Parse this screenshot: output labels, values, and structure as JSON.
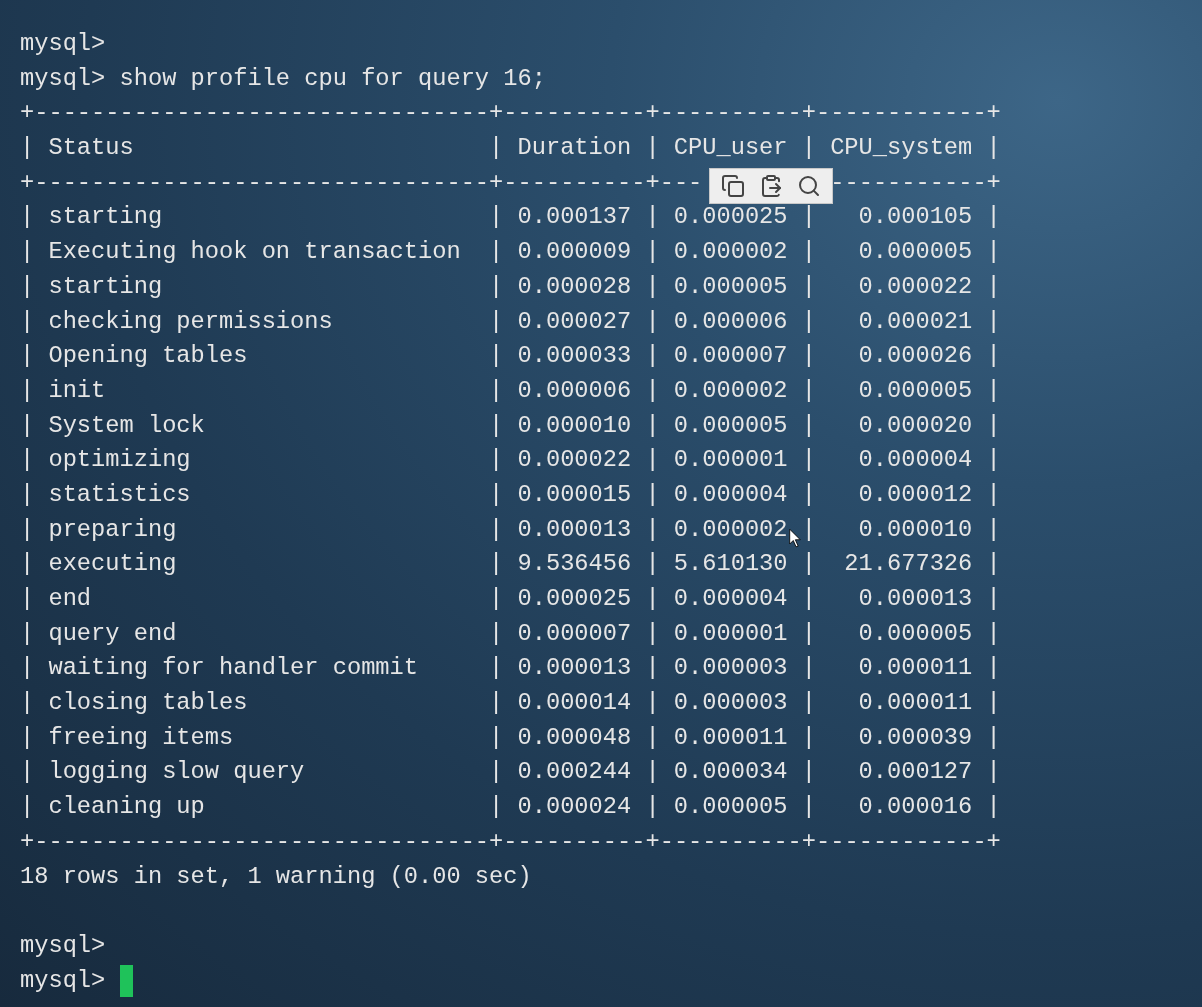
{
  "terminal": {
    "lines_before": [
      {
        "prompt": "mysql>",
        "cursor": false
      },
      {
        "prompt": "mysql>",
        "command": "show profile cpu for query 16;",
        "cursor": false
      }
    ],
    "table": {
      "border": {
        "corner": "+",
        "horizontal": "-",
        "vertical": "|"
      },
      "columns": [
        {
          "label": "Status"
        },
        {
          "label": "Duration"
        },
        {
          "label": "CPU_user"
        },
        {
          "label": "CPU_system"
        }
      ],
      "header_rule_visible_parts": [
        "+--------------------------------+----------+---",
        "-----------+"
      ],
      "rows": [
        [
          "starting",
          "0.000137",
          "0.000025",
          "0.000105"
        ],
        [
          "Executing hook on transaction",
          "0.000009",
          "0.000002",
          "0.000005"
        ],
        [
          "starting",
          "0.000028",
          "0.000005",
          "0.000022"
        ],
        [
          "checking permissions",
          "0.000027",
          "0.000006",
          "0.000021"
        ],
        [
          "Opening tables",
          "0.000033",
          "0.000007",
          "0.000026"
        ],
        [
          "init",
          "0.000006",
          "0.000002",
          "0.000005"
        ],
        [
          "System lock",
          "0.000010",
          "0.000005",
          "0.000020"
        ],
        [
          "optimizing",
          "0.000022",
          "0.000001",
          "0.000004"
        ],
        [
          "statistics",
          "0.000015",
          "0.000004",
          "0.000012"
        ],
        [
          "preparing",
          "0.000013",
          "0.000002",
          "0.000010"
        ],
        [
          "executing",
          "9.536456",
          "5.610130",
          "21.677326"
        ],
        [
          "end",
          "0.000025",
          "0.000004",
          "0.000013"
        ],
        [
          "query end",
          "0.000007",
          "0.000001",
          "0.000005"
        ],
        [
          "waiting for handler commit",
          "0.000013",
          "0.000003",
          "0.000011"
        ],
        [
          "closing tables",
          "0.000014",
          "0.000003",
          "0.000011"
        ],
        [
          "freeing items",
          "0.000048",
          "0.000011",
          "0.000039"
        ],
        [
          "logging slow query",
          "0.000244",
          "0.000034",
          "0.000127"
        ],
        [
          "cleaning up",
          "0.000024",
          "0.000005",
          "0.000016"
        ]
      ]
    },
    "summary": "18 rows in set, 1 warning (0.00 sec)",
    "lines_after": [
      {
        "prompt": "mysql>",
        "cursor": false
      },
      {
        "prompt": "mysql>",
        "cursor": true
      }
    ]
  },
  "popup_toolbar": {
    "buttons": [
      {
        "kind": "copy"
      },
      {
        "kind": "paste"
      },
      {
        "kind": "search"
      }
    ]
  }
}
